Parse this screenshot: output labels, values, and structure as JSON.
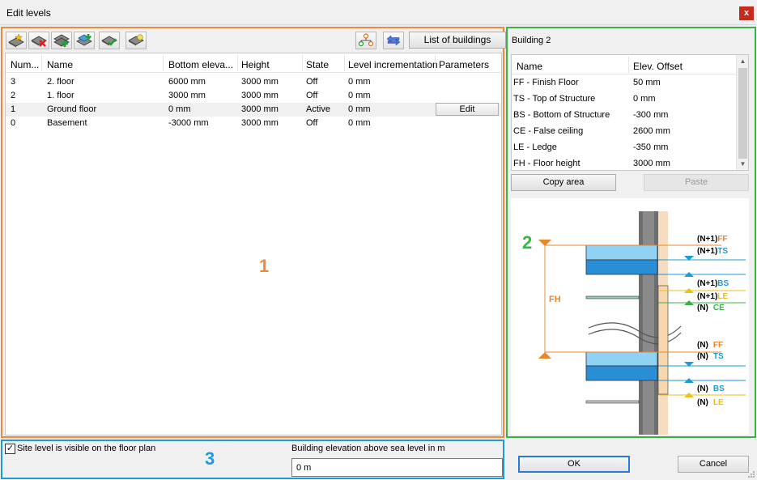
{
  "window": {
    "title": "Edit levels",
    "close_glyph": "x"
  },
  "colors": {
    "panel1": "#f0883e",
    "panel2": "#3cb14a",
    "panel3": "#1e9ad6",
    "accent_blue": "#2a7ad1"
  },
  "toolbar": {
    "icons": [
      "new-level-icon",
      "delete-level-icon",
      "add-level-below-icon",
      "add-level-above-icon",
      "edit-level-icon",
      "level-properties-icon",
      "level-tree-icon",
      "swap-arrows-icon"
    ],
    "list_buildings_label": "List of buildings"
  },
  "levels_table": {
    "columns": [
      "Num...",
      "Name",
      "Bottom eleva...",
      "Height",
      "State",
      "Level incrementation",
      "Parameters"
    ],
    "rows": [
      {
        "num": "3",
        "name": "2. floor",
        "bottom": "6000 mm",
        "height": "3000 mm",
        "state": "Off",
        "incr": "0 mm",
        "param": ""
      },
      {
        "num": "2",
        "name": "1. floor",
        "bottom": "3000 mm",
        "height": "3000 mm",
        "state": "Off",
        "incr": "0 mm",
        "param": ""
      },
      {
        "num": "1",
        "name": "Ground floor",
        "bottom": "0 mm",
        "height": "3000 mm",
        "state": "Active",
        "incr": "0 mm",
        "param": "Edit"
      },
      {
        "num": "0",
        "name": "Basement",
        "bottom": "-3000 mm",
        "height": "3000 mm",
        "state": "Off",
        "incr": "0 mm",
        "param": ""
      }
    ]
  },
  "annotations": {
    "one": "1",
    "two": "2",
    "three": "3"
  },
  "building": {
    "name": "Building 2",
    "columns": [
      "Name",
      "Elev. Offset"
    ],
    "rows": [
      {
        "name": "FF - Finish Floor",
        "offset": "50 mm"
      },
      {
        "name": "TS - Top of Structure",
        "offset": "0 mm"
      },
      {
        "name": "BS - Bottom of Structure",
        "offset": "-300 mm"
      },
      {
        "name": "CE - False ceiling",
        "offset": "2600 mm"
      },
      {
        "name": "LE - Ledge",
        "offset": "-350 mm"
      },
      {
        "name": "FH - Floor height",
        "offset": "3000 mm"
      }
    ],
    "copy_label": "Copy area",
    "paste_label": "Paste"
  },
  "diagram": {
    "fh_label": "FH",
    "labels_upper": [
      {
        "prefix": "(N+1)",
        "code": "FF",
        "color": "#e8862a"
      },
      {
        "prefix": "(N+1)",
        "code": "TS",
        "color": "#1e9ad6"
      },
      {
        "prefix": "(N+1)",
        "code": "BS",
        "color": "#1e9ad6"
      },
      {
        "prefix": "(N+1)",
        "code": "LE",
        "color": "#e8c21a"
      },
      {
        "prefix": "(N)",
        "code": "CE",
        "color": "#3cb14a"
      }
    ],
    "labels_lower": [
      {
        "prefix": "(N)",
        "code": "FF",
        "color": "#e8862a"
      },
      {
        "prefix": "(N)",
        "code": "TS",
        "color": "#1e9ad6"
      },
      {
        "prefix": "(N)",
        "code": "BS",
        "color": "#1e9ad6"
      },
      {
        "prefix": "(N)",
        "code": "LE",
        "color": "#e8c21a"
      }
    ]
  },
  "site": {
    "checkbox_label": "Site level is visible on the floor plan",
    "checkbox_checked": true,
    "elevation_label": "Building elevation above sea level in m",
    "elevation_value": "0 m"
  },
  "buttons": {
    "ok": "OK",
    "cancel": "Cancel"
  }
}
